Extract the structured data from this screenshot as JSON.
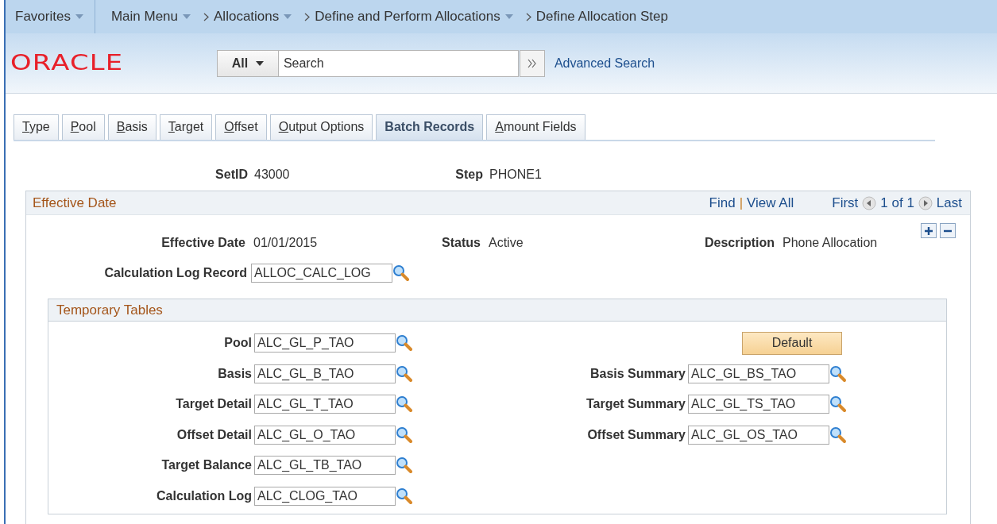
{
  "breadcrumb": [
    {
      "label": "Favorites",
      "dropdown": true,
      "chevron": false
    },
    {
      "label": "Main Menu",
      "dropdown": true,
      "chevron": false
    },
    {
      "label": "Allocations",
      "dropdown": true,
      "chevron": true
    },
    {
      "label": "Define and Perform Allocations",
      "dropdown": true,
      "chevron": true
    },
    {
      "label": "Define Allocation Step",
      "dropdown": false,
      "chevron": true
    }
  ],
  "logo": "ORACLE",
  "search": {
    "scope": "All",
    "placeholder": "Search",
    "advanced_link": "Advanced Search"
  },
  "tabs": [
    {
      "label": "Type",
      "selected": false,
      "hotkey": true
    },
    {
      "label": "Pool",
      "selected": false,
      "hotkey": true
    },
    {
      "label": "Basis",
      "selected": false,
      "hotkey": true
    },
    {
      "label": "Target",
      "selected": false,
      "hotkey": true
    },
    {
      "label": "Offset",
      "selected": false,
      "hotkey": true
    },
    {
      "label": "Output Options",
      "selected": false,
      "hotkey": true
    },
    {
      "label": "Batch Records",
      "selected": true,
      "hotkey": false
    },
    {
      "label": "Amount Fields",
      "selected": false,
      "hotkey": true
    }
  ],
  "keys": [
    {
      "label": "SetID",
      "value": "43000"
    },
    {
      "label": "Step",
      "value": "PHONE1"
    }
  ],
  "effective_date": {
    "title": "Effective Date",
    "links": [
      "Find",
      "View All"
    ],
    "link_separator": "|",
    "pager": {
      "first": "First",
      "count": "1 of 1",
      "last": "Last"
    },
    "fields": [
      {
        "label": "Effective Date",
        "value": "01/01/2015"
      },
      {
        "label": "Status",
        "value": "Active"
      },
      {
        "label": "Description",
        "value": "Phone Allocation"
      }
    ],
    "calc_log_record": {
      "label": "Calculation Log Record",
      "value": "ALLOC_CALC_LOG"
    }
  },
  "temporary_tables": {
    "title": "Temporary Tables",
    "default_button": "Default",
    "left": [
      {
        "label": "Pool",
        "value": "ALC_GL_P_TAO"
      },
      {
        "label": "Basis",
        "value": "ALC_GL_B_TAO"
      },
      {
        "label": "Target Detail",
        "value": "ALC_GL_T_TAO"
      },
      {
        "label": "Offset Detail",
        "value": "ALC_GL_O_TAO"
      },
      {
        "label": "Target Balance",
        "value": "ALC_GL_TB_TAO"
      },
      {
        "label": "Calculation Log",
        "value": "ALC_CLOG_TAO"
      }
    ],
    "right": [
      {
        "label": "Basis Summary",
        "value": "ALC_GL_BS_TAO"
      },
      {
        "label": "Target Summary",
        "value": "ALC_GL_TS_TAO"
      },
      {
        "label": "Offset Summary",
        "value": "ALC_GL_OS_TAO"
      }
    ]
  }
}
